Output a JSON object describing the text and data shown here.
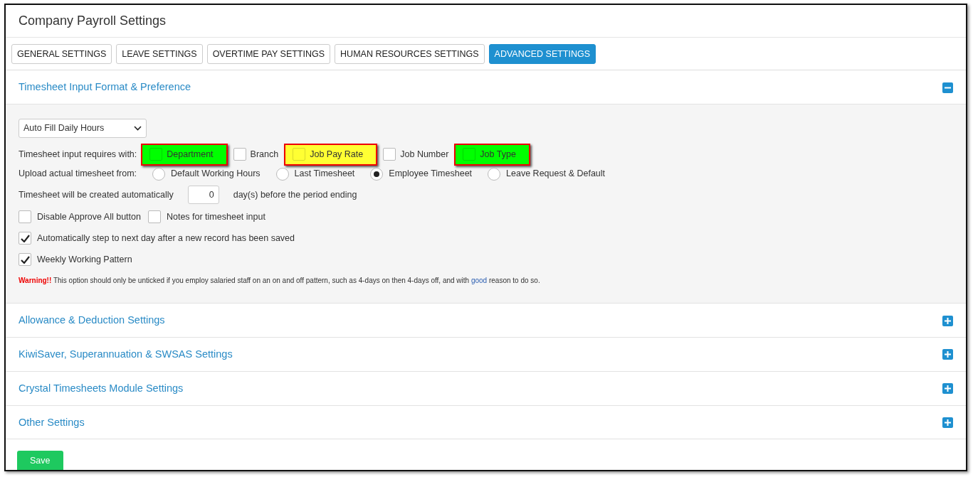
{
  "title": "Company Payroll Settings",
  "tabs": [
    {
      "label": "GENERAL SETTINGS",
      "selected": false
    },
    {
      "label": "LEAVE SETTINGS",
      "selected": false
    },
    {
      "label": "OVERTIME PAY SETTINGS",
      "selected": false
    },
    {
      "label": "HUMAN RESOURCES SETTINGS",
      "selected": false
    },
    {
      "label": "ADVANCED SETTINGS",
      "selected": true
    }
  ],
  "sections": [
    {
      "title": "Timesheet Input Format & Preference",
      "expanded": true,
      "body": {
        "mode_select": {
          "value": "Auto Fill Daily Hours"
        },
        "requires": {
          "label": "Timesheet input requires with:",
          "options": [
            {
              "label": "Department",
              "checked": false,
              "color": "#00ff00"
            },
            {
              "label": "Branch",
              "checked": false
            },
            {
              "label": "Job Pay Rate",
              "checked": false,
              "color": "#ffff33"
            },
            {
              "label": "Job Number",
              "checked": false
            },
            {
              "label": "Job Type",
              "checked": false,
              "color": "#00ff00"
            }
          ]
        },
        "upload": {
          "label": "Upload actual timesheet from:",
          "options": [
            {
              "label": "Default Working Hours",
              "selected": false
            },
            {
              "label": "Last Timesheet",
              "selected": false
            },
            {
              "label": "Employee Timesheet",
              "selected": true
            },
            {
              "label": "Leave Request & Default",
              "selected": false
            }
          ]
        },
        "auto_create": {
          "label": "Timesheet will be created automatically",
          "value": "0",
          "suffix": "day(s) before the period ending"
        },
        "check_rows": [
          [
            {
              "label": "Disable Approve All button",
              "checked": false
            },
            {
              "label": "Notes for timesheet input",
              "checked": false
            }
          ],
          [
            {
              "label": "Automatically step to next day after a new record has been saved",
              "checked": true
            }
          ],
          [
            {
              "label": "Weekly Working Pattern",
              "checked": true
            }
          ]
        ],
        "warning": {
          "label": "Warning!!",
          "text": "This option should only be unticked if you employ salaried staff on an on and off pattern, such as 4-days on then 4-days off, and with",
          "link": "good",
          "after": "reason to do so."
        }
      }
    },
    {
      "title": "Allowance & Deduction Settings",
      "expanded": false
    },
    {
      "title": "KiwiSaver, Superannuation & SWSAS Settings",
      "expanded": false
    },
    {
      "title": "Crystal Timesheets Module Settings",
      "expanded": false
    },
    {
      "title": "Other Settings",
      "expanded": false
    }
  ],
  "save_button": "Save"
}
